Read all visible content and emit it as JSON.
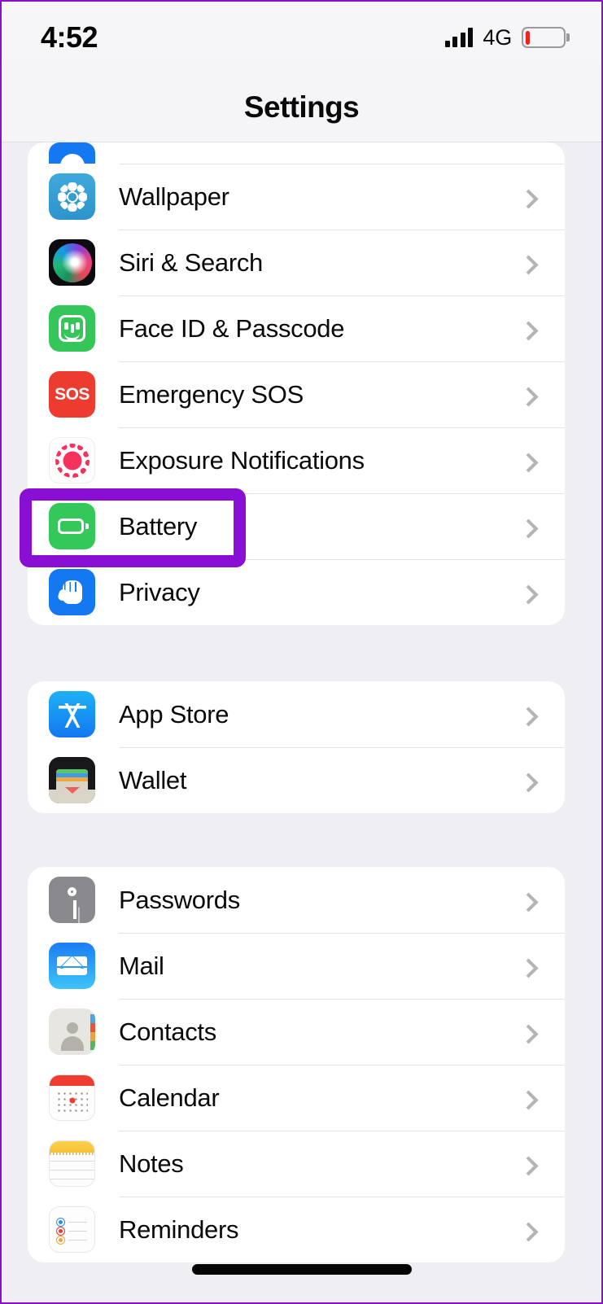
{
  "statusbar": {
    "time": "4:52",
    "network": "4G",
    "signal_icon": "signal-bars-icon",
    "battery_icon": "battery-low-icon",
    "battery_level_percent": 12
  },
  "navbar": {
    "title": "Settings"
  },
  "sections": [
    {
      "id": "system",
      "rows": [
        {
          "label": "",
          "icon": "display-brightness-icon",
          "partial": true
        },
        {
          "label": "Wallpaper",
          "icon": "wallpaper-icon"
        },
        {
          "label": "Siri & Search",
          "icon": "siri-icon"
        },
        {
          "label": "Face ID & Passcode",
          "icon": "face-id-icon"
        },
        {
          "label": "Emergency SOS",
          "icon": "emergency-sos-icon"
        },
        {
          "label": "Exposure Notifications",
          "icon": "exposure-notifications-icon"
        },
        {
          "label": "Battery",
          "icon": "battery-icon",
          "highlighted": true
        },
        {
          "label": "Privacy",
          "icon": "privacy-icon"
        }
      ]
    },
    {
      "id": "stores",
      "rows": [
        {
          "label": "App Store",
          "icon": "app-store-icon"
        },
        {
          "label": "Wallet",
          "icon": "wallet-icon"
        }
      ]
    },
    {
      "id": "apps",
      "rows": [
        {
          "label": "Passwords",
          "icon": "passwords-icon"
        },
        {
          "label": "Mail",
          "icon": "mail-icon"
        },
        {
          "label": "Contacts",
          "icon": "contacts-icon"
        },
        {
          "label": "Calendar",
          "icon": "calendar-icon"
        },
        {
          "label": "Notes",
          "icon": "notes-icon"
        },
        {
          "label": "Reminders",
          "icon": "reminders-icon"
        }
      ]
    }
  ],
  "annotation": {
    "target": "Battery",
    "color": "#8A0FD4",
    "shape": "rounded-rectangle"
  },
  "colors": {
    "page_background": "#EFEEF3",
    "card_background": "#FFFFFF",
    "separator": "#E3E3E6",
    "chevron": "#B3B3B8",
    "label_text": "#0A0A0A",
    "annotation_purple": "#8A0FD4",
    "battery_red": "#F2211B"
  },
  "home_indicator": {
    "visible": true
  }
}
